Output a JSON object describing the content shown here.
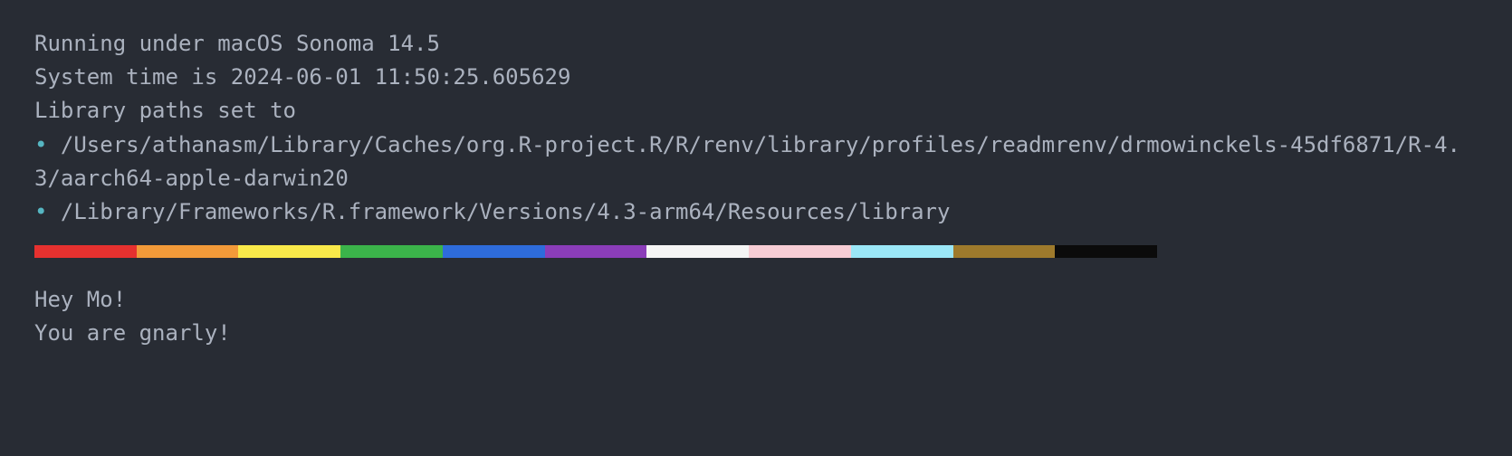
{
  "terminal": {
    "line1": "Running under macOS Sonoma 14.5",
    "line2": "System time is 2024-06-01 11:50:25.605629",
    "line3": "Library paths set to",
    "bullet": "•",
    "path1": " /Users/athanasm/Library/Caches/org.R-project.R/R/renv/library/profiles/readmrenv/drmowinckels-45df6871/R-4.3/aarch64-apple-darwin20",
    "path2": " /Library/Frameworks/R.framework/Versions/4.3-arm64/Resources/library",
    "greeting1": "Hey Mo!",
    "greeting2": "You are gnarly!"
  },
  "stripes": [
    "#e6312f",
    "#f29a39",
    "#f9e94a",
    "#3bb44a",
    "#2e6cdb",
    "#8b3db9",
    "#f5f5f5",
    "#f7cdd5",
    "#9be7f7",
    "#9e7a2c",
    "#0b0b0b"
  ]
}
